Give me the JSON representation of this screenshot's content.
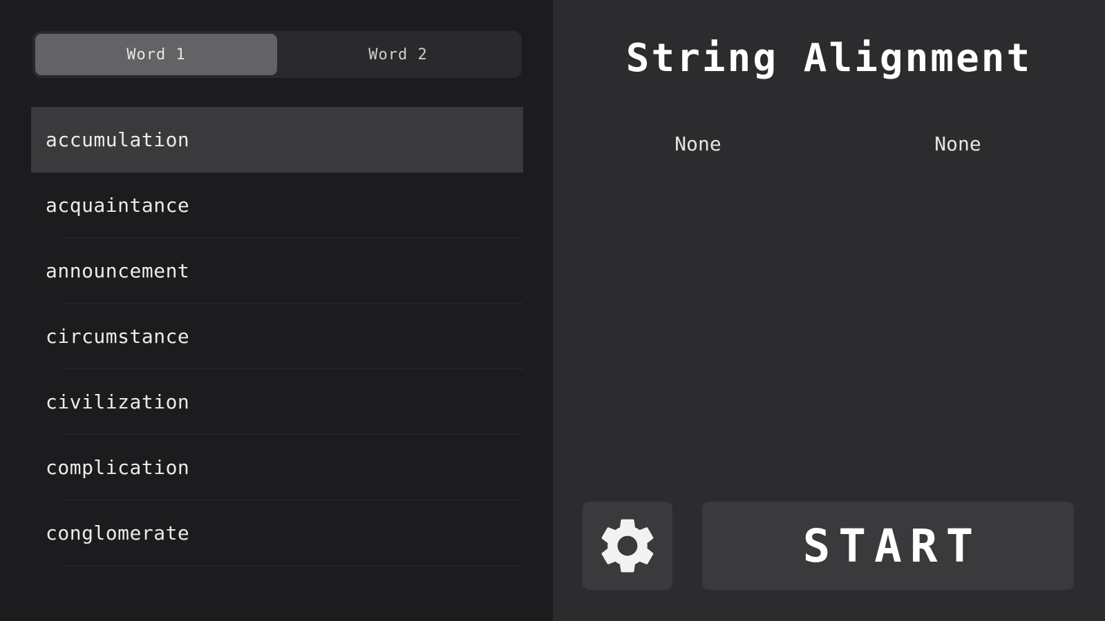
{
  "app": {
    "title": "String Alignment"
  },
  "tabs": [
    {
      "label": "Word 1",
      "active": true
    },
    {
      "label": "Word 2",
      "active": false
    }
  ],
  "words": [
    {
      "label": "accumulation",
      "selected": true
    },
    {
      "label": "acquaintance",
      "selected": false
    },
    {
      "label": "announcement",
      "selected": false
    },
    {
      "label": "circumstance",
      "selected": false
    },
    {
      "label": "civilization",
      "selected": false
    },
    {
      "label": "complication",
      "selected": false
    },
    {
      "label": "conglomerate",
      "selected": false
    }
  ],
  "results": {
    "word1": "None",
    "word2": "None"
  },
  "controls": {
    "settings_icon": "gear-icon",
    "start_label": "START"
  },
  "colors": {
    "left_bg": "#1c1c1e",
    "right_bg": "#2c2c2e",
    "selected_row": "#3a3a3c",
    "active_tab": "#636366",
    "button_bg": "#3a3a3c"
  }
}
